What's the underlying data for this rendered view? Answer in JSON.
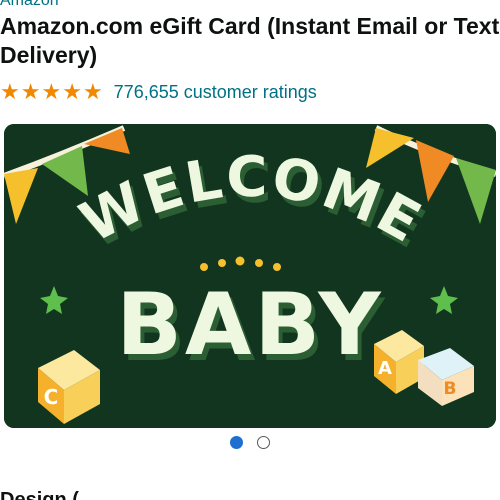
{
  "product": {
    "brand": "Amazon",
    "title": "Amazon.com eGift Card (Instant Email or Text Delivery)",
    "rating_stars": 5,
    "ratings_count_text": "776,655 customer ratings"
  },
  "card_image": {
    "line1": "WELCOME",
    "line2": "BABY",
    "block_c": "C",
    "block_a": "A",
    "block_b": "B",
    "colors": {
      "background": "#12351f",
      "text": "#eef7df",
      "banner_yellow": "#f5c02c",
      "banner_orange": "#f08a24",
      "banner_green": "#73b84a",
      "star": "#5fbf4d"
    }
  },
  "carousel": {
    "total": 2,
    "active_index": 0
  },
  "cutoff_text": "Design ("
}
